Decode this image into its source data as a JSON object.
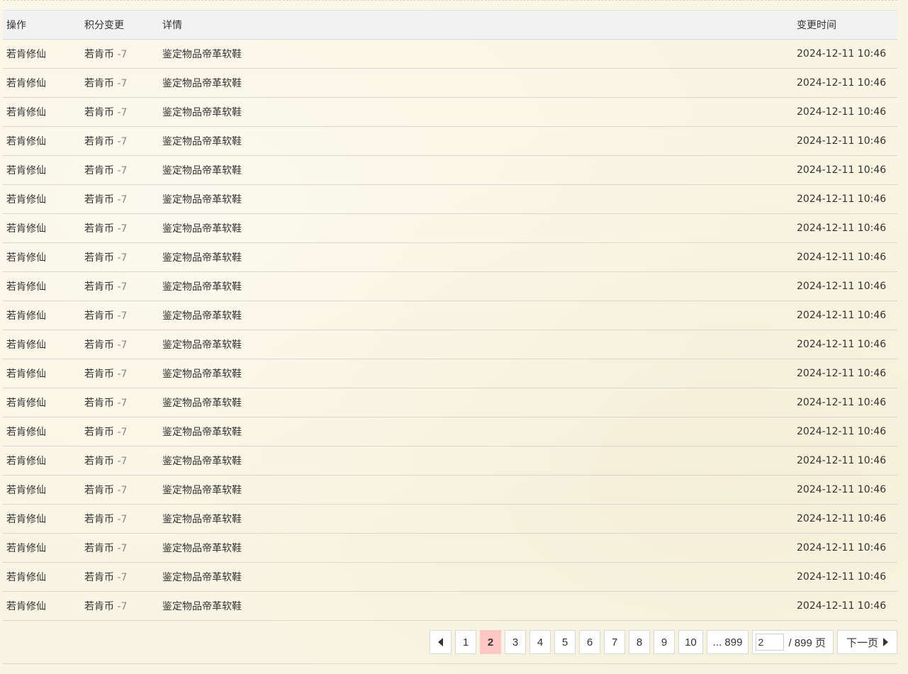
{
  "table": {
    "headers": [
      "操作",
      "积分变更",
      "详情",
      "变更时间"
    ],
    "rows": [
      {
        "action": "若肯修仙",
        "currency": "若肯币",
        "delta": "-7",
        "detail": "鉴定物品帝革软鞋",
        "time": "2024-12-11 10:46"
      },
      {
        "action": "若肯修仙",
        "currency": "若肯币",
        "delta": "-7",
        "detail": "鉴定物品帝革软鞋",
        "time": "2024-12-11 10:46"
      },
      {
        "action": "若肯修仙",
        "currency": "若肯币",
        "delta": "-7",
        "detail": "鉴定物品帝革软鞋",
        "time": "2024-12-11 10:46"
      },
      {
        "action": "若肯修仙",
        "currency": "若肯币",
        "delta": "-7",
        "detail": "鉴定物品帝革软鞋",
        "time": "2024-12-11 10:46"
      },
      {
        "action": "若肯修仙",
        "currency": "若肯币",
        "delta": "-7",
        "detail": "鉴定物品帝革软鞋",
        "time": "2024-12-11 10:46"
      },
      {
        "action": "若肯修仙",
        "currency": "若肯币",
        "delta": "-7",
        "detail": "鉴定物品帝革软鞋",
        "time": "2024-12-11 10:46"
      },
      {
        "action": "若肯修仙",
        "currency": "若肯币",
        "delta": "-7",
        "detail": "鉴定物品帝革软鞋",
        "time": "2024-12-11 10:46"
      },
      {
        "action": "若肯修仙",
        "currency": "若肯币",
        "delta": "-7",
        "detail": "鉴定物品帝革软鞋",
        "time": "2024-12-11 10:46"
      },
      {
        "action": "若肯修仙",
        "currency": "若肯币",
        "delta": "-7",
        "detail": "鉴定物品帝革软鞋",
        "time": "2024-12-11 10:46"
      },
      {
        "action": "若肯修仙",
        "currency": "若肯币",
        "delta": "-7",
        "detail": "鉴定物品帝革软鞋",
        "time": "2024-12-11 10:46"
      },
      {
        "action": "若肯修仙",
        "currency": "若肯币",
        "delta": "-7",
        "detail": "鉴定物品帝革软鞋",
        "time": "2024-12-11 10:46"
      },
      {
        "action": "若肯修仙",
        "currency": "若肯币",
        "delta": "-7",
        "detail": "鉴定物品帝革软鞋",
        "time": "2024-12-11 10:46"
      },
      {
        "action": "若肯修仙",
        "currency": "若肯币",
        "delta": "-7",
        "detail": "鉴定物品帝革软鞋",
        "time": "2024-12-11 10:46"
      },
      {
        "action": "若肯修仙",
        "currency": "若肯币",
        "delta": "-7",
        "detail": "鉴定物品帝革软鞋",
        "time": "2024-12-11 10:46"
      },
      {
        "action": "若肯修仙",
        "currency": "若肯币",
        "delta": "-7",
        "detail": "鉴定物品帝革软鞋",
        "time": "2024-12-11 10:46"
      },
      {
        "action": "若肯修仙",
        "currency": "若肯币",
        "delta": "-7",
        "detail": "鉴定物品帝革软鞋",
        "time": "2024-12-11 10:46"
      },
      {
        "action": "若肯修仙",
        "currency": "若肯币",
        "delta": "-7",
        "detail": "鉴定物品帝革软鞋",
        "time": "2024-12-11 10:46"
      },
      {
        "action": "若肯修仙",
        "currency": "若肯币",
        "delta": "-7",
        "detail": "鉴定物品帝革软鞋",
        "time": "2024-12-11 10:46"
      },
      {
        "action": "若肯修仙",
        "currency": "若肯币",
        "delta": "-7",
        "detail": "鉴定物品帝革软鞋",
        "time": "2024-12-11 10:46"
      },
      {
        "action": "若肯修仙",
        "currency": "若肯币",
        "delta": "-7",
        "detail": "鉴定物品帝革软鞋",
        "time": "2024-12-11 10:46"
      }
    ]
  },
  "pagination": {
    "prev_icon": "triangle-left-icon",
    "pages": [
      "1",
      "2",
      "3",
      "4",
      "5",
      "6",
      "7",
      "8",
      "9",
      "10"
    ],
    "current": "2",
    "last_page_label": "... 899",
    "jump_value": "2",
    "total_label": "/ 899 页",
    "next_label": "下一页",
    "next_icon": "triangle-right-icon",
    "current_bg": "#ffc6c6"
  }
}
